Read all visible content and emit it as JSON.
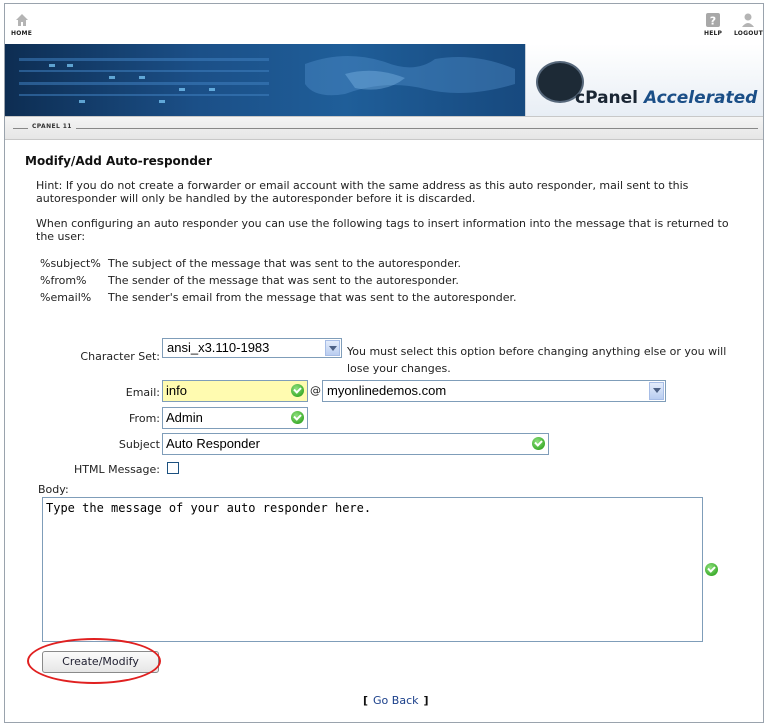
{
  "nav": {
    "home_label": "HOME",
    "help_label": "HELP",
    "logout_label": "LOGOUT"
  },
  "banner": {
    "logo_text_prefix": "cPanel",
    "logo_text_suffix": "Accelerated"
  },
  "breadcrumb": {
    "label": "CPANEL 11"
  },
  "page": {
    "title": "Modify/Add Auto-responder",
    "hint": "Hint: If you do not create a forwarder or email account with the same address as this auto responder, mail sent to this autoresponder will only be handled by the autoresponder before it is discarded.",
    "tags_intro": "When configuring an auto responder you can use the following tags to insert information into the message that is returned to the user:",
    "tags": [
      {
        "tag": "%subject%",
        "desc": "The subject of the message that was sent to the autoresponder."
      },
      {
        "tag": "%from%",
        "desc": "The sender of the message that was sent to the autoresponder."
      },
      {
        "tag": "%email%",
        "desc": "The sender's email from the message that was sent to the autoresponder."
      }
    ]
  },
  "form": {
    "charset_label": "Character Set:",
    "charset_value": "ansi_x3.110-1983",
    "charset_note_line1": "You must select this option before changing anything else or you will",
    "charset_note_line2": "lose your changes.",
    "email_label": "Email:",
    "email_value": "info",
    "at_sign": "@",
    "domain_value": "myonlinedemos.com",
    "from_label": "From:",
    "from_value": "Admin",
    "subject_label": "Subject",
    "subject_value": "Auto Responder",
    "html_label": "HTML Message:",
    "html_checked": false,
    "body_label": "Body:",
    "body_value": "Type the message of your auto responder here.",
    "submit_label": "Create/Modify"
  },
  "footer": {
    "open_bracket": "[",
    "go_back_label": "Go Back",
    "close_bracket": "]"
  },
  "colors": {
    "banner_blue": "#1b4f87",
    "highlight_red": "#e02020",
    "valid_green": "#3fae2f",
    "email_field_bg": "#fffbb0"
  }
}
